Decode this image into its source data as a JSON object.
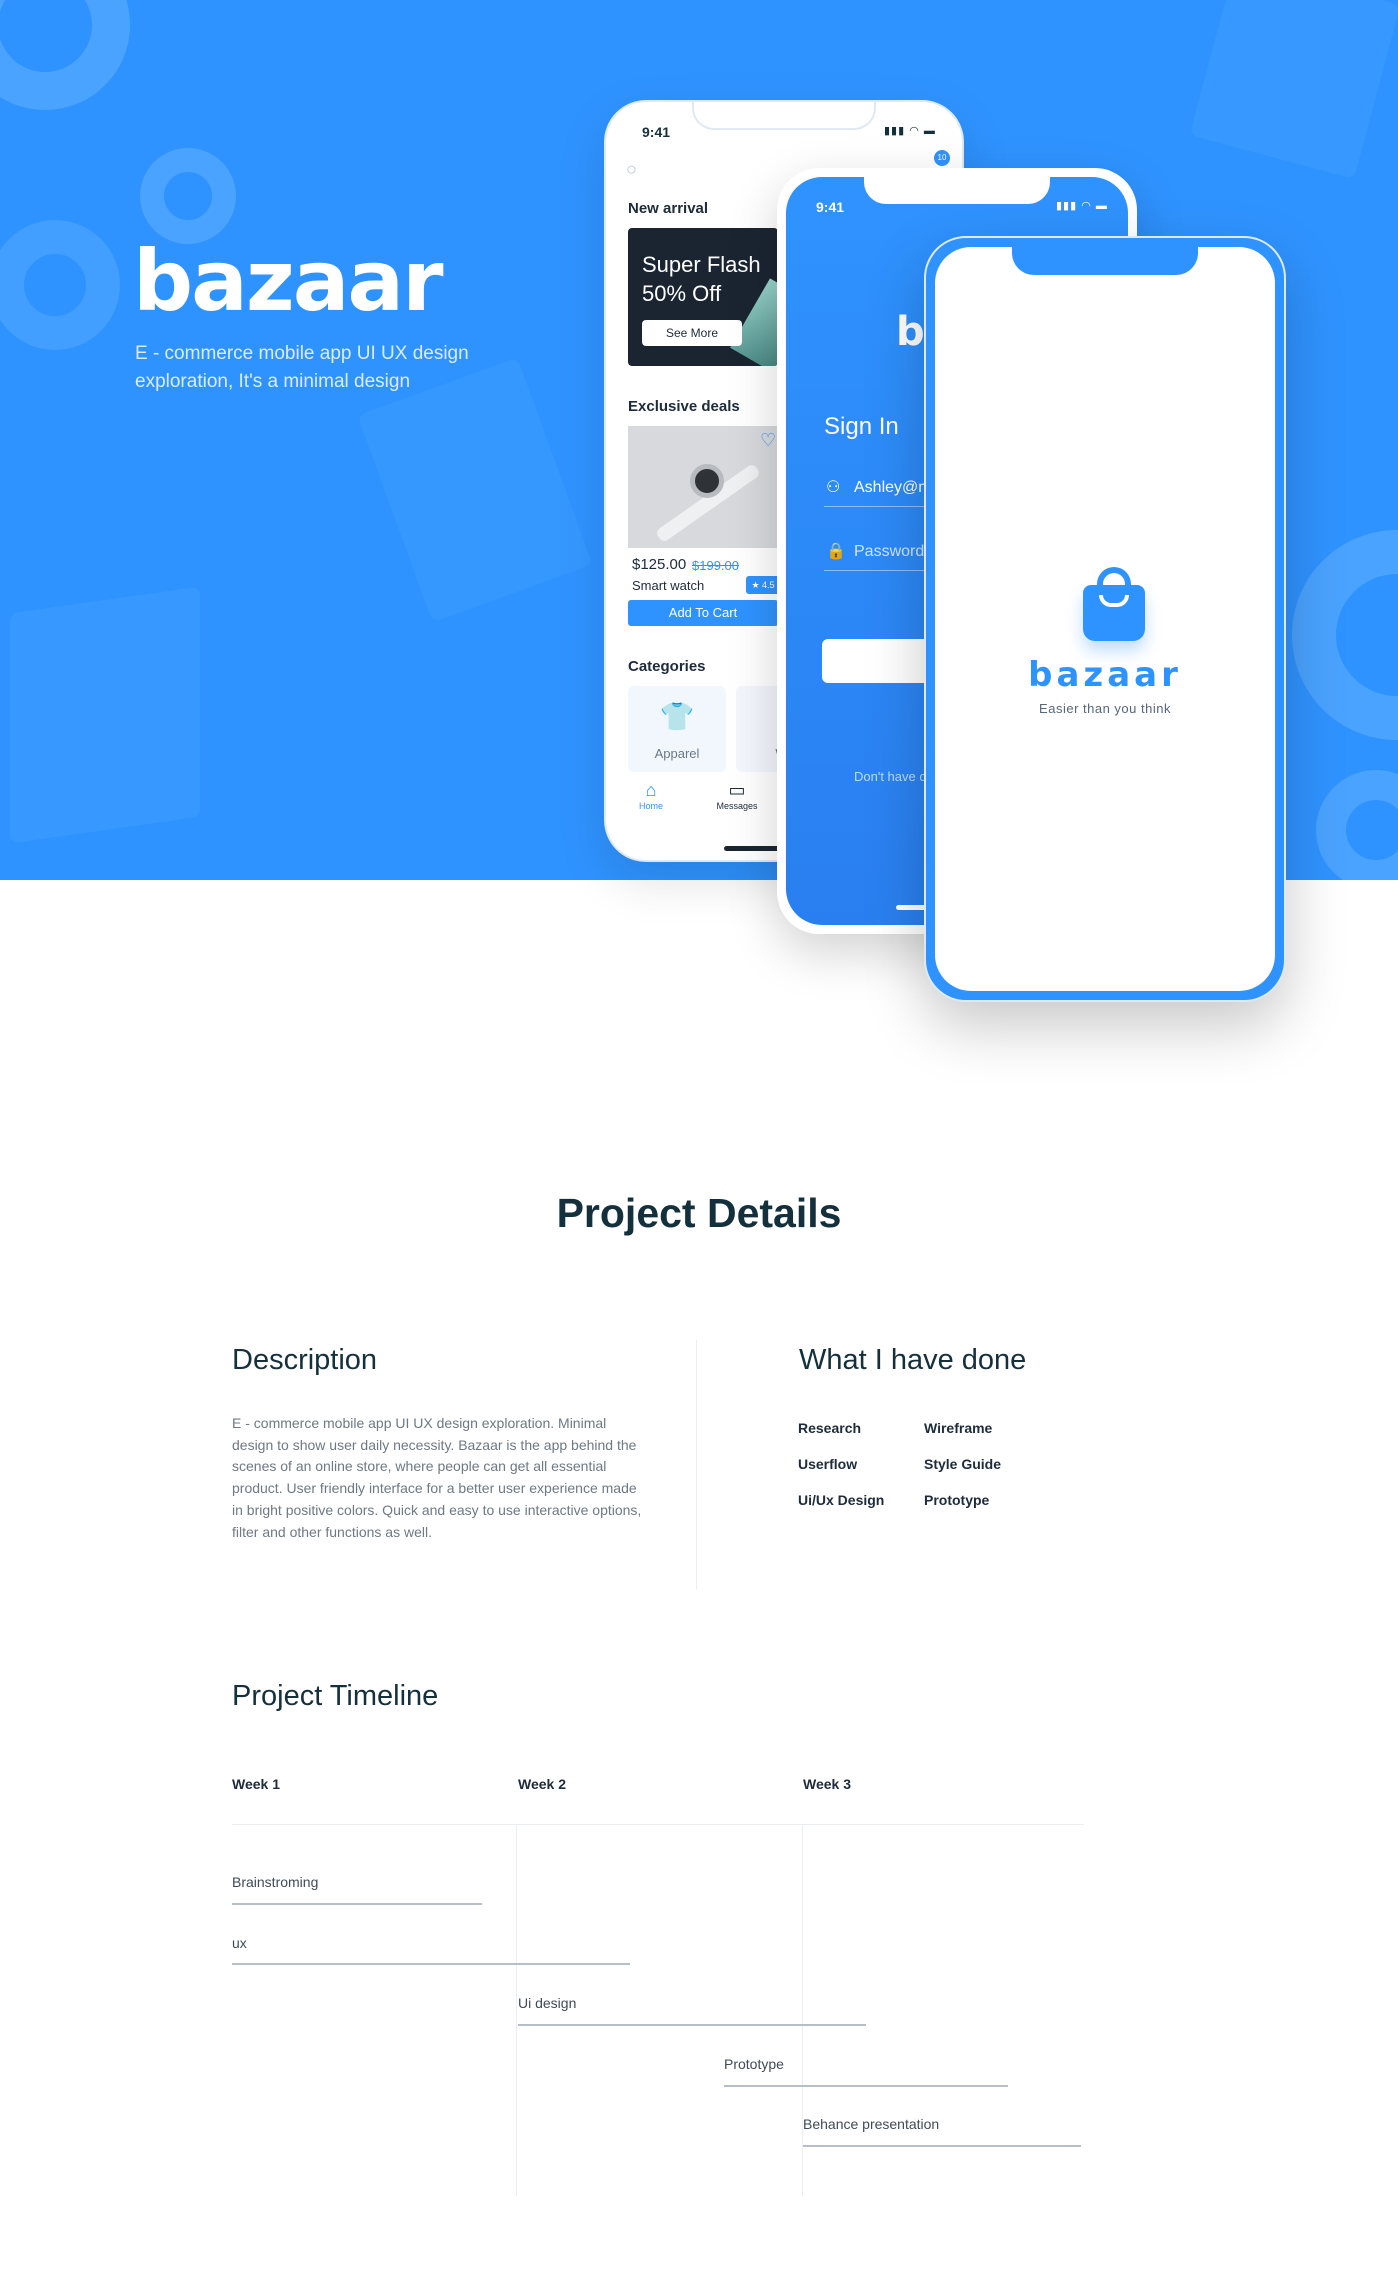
{
  "hero": {
    "title": "bazaar",
    "subtitle": "E - commerce mobile app UI UX design exploration, It's a minimal design"
  },
  "colors": {
    "brand_blue": "#2f93ff",
    "dark_text": "#14303d",
    "muted_text": "#6d7983"
  },
  "phone_home": {
    "time": "9:41",
    "notification_count": "10",
    "new_arrival_title": "New arrival",
    "flash_line1": "Super Flash",
    "flash_line2": "50% Off",
    "see_more": "See More",
    "exclusive_title": "Exclusive deals",
    "price": "$125.00",
    "old_price": "$199.00",
    "product_name": "Smart watch",
    "rating": "★ 4.5",
    "add_to_cart": "Add To Cart",
    "categories_title": "Categories",
    "category_1": "Apparel",
    "category_2": "Wo",
    "tab_home": "Home",
    "tab_messages": "Messages",
    "icons": [
      "search-icon",
      "heart-icon",
      "shirt-icon",
      "home-icon",
      "chat-icon"
    ]
  },
  "phone_signin": {
    "time": "9:41",
    "brand": "bo",
    "title": "Sign In",
    "email_value": "Ashley@m",
    "password_placeholder": "Password",
    "footer": "Don't have c",
    "icons": [
      "user-icon",
      "lock-icon"
    ]
  },
  "phone_splash": {
    "brand": "bazaar",
    "tagline": "Easier than you think"
  },
  "details": {
    "title": "Project Details",
    "description_heading": "Description",
    "description_text": "E - commerce mobile app UI UX design exploration. Minimal design to show user daily necessity. Bazaar is the app behind the scenes of an online store, where people can get all essential product. User friendly interface for a better user experience made in bright positive colors. Quick and easy to use interactive options, filter and other functions as well.",
    "done_heading": "What I have done",
    "done_items": [
      "Research",
      "Wireframe",
      "Userflow",
      "Style Guide",
      "Ui/Ux Design",
      "Prototype"
    ]
  },
  "timeline": {
    "title": "Project Timeline",
    "weeks": [
      "Week 1",
      "Week 2",
      "Week 3"
    ],
    "tasks": [
      "Brainstroming",
      "ux",
      "Ui design",
      "Prototype",
      "Behance presentation"
    ]
  }
}
